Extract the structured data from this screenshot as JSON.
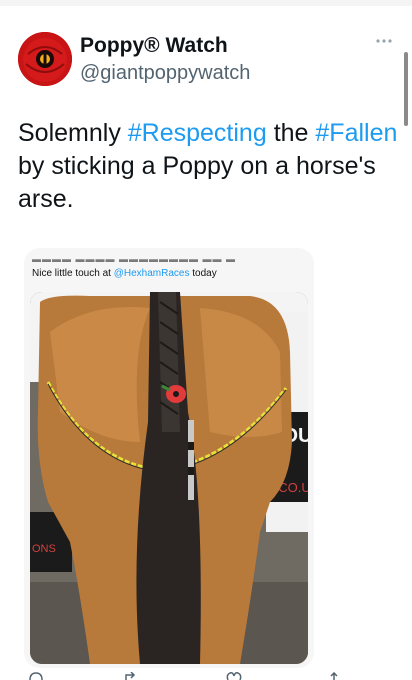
{
  "account": {
    "name": "Poppy® Watch",
    "handle": "@giantpoppywatch"
  },
  "tweet": {
    "text_parts": [
      {
        "text": "Solemnly ",
        "hashtag": false
      },
      {
        "text": "#Respecting",
        "hashtag": true
      },
      {
        "text": " the ",
        "hashtag": false
      },
      {
        "text": "#Fallen",
        "hashtag": true
      },
      {
        "text": " by sticking a Poppy on a horse's arse.",
        "hashtag": false
      }
    ]
  },
  "embedded": {
    "caption_before": "Nice little touch at ",
    "caption_mention": "@HexhamRaces",
    "caption_after": " today",
    "sign_text_1": "COUR",
    "sign_text_2": "S.CO.UK",
    "sign_text_3": "ONS",
    "sign_text_4": "LI"
  },
  "colors": {
    "hashtag": "#1d9bf0",
    "handle": "#536471",
    "poppy": "#e23b3b"
  },
  "icons": [
    "poppy-avatar-icon",
    "more-options-icon",
    "reply-icon",
    "retweet-icon",
    "like-icon",
    "share-icon"
  ]
}
